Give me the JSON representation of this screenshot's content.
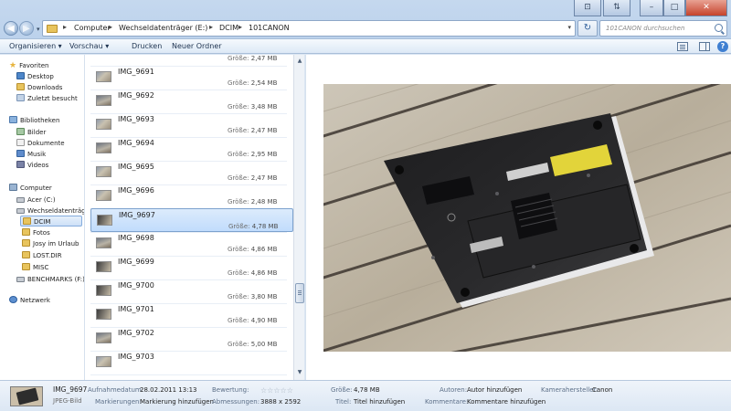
{
  "window": {
    "controls": {
      "minimize": "–",
      "maximize": "□",
      "close": "✕"
    }
  },
  "address": {
    "crumbs": [
      "Computer",
      "Wechseldatenträger (E:)",
      "DCIM",
      "101CANON"
    ]
  },
  "search": {
    "placeholder": "101CANON durchsuchen"
  },
  "toolbar": {
    "organize": "Organisieren ▾",
    "preview": "Vorschau ▾",
    "print": "Drucken",
    "new_folder": "Neuer Ordner"
  },
  "navpane": {
    "favorites": "Favoriten",
    "desktop": "Desktop",
    "downloads": "Downloads",
    "recent": "Zuletzt besucht",
    "libraries": "Bibliotheken",
    "pictures": "Bilder",
    "documents": "Dokumente",
    "music": "Musik",
    "videos": "Videos",
    "computer": "Computer",
    "drive_c": "Acer (C:)",
    "drive_e": "Wechseldatenträger",
    "dcim": "DCIM",
    "fotos": "Fotos",
    "urlaub": "Josy im Urlaub",
    "lostdir": "LOST.DIR",
    "misc": "MISC",
    "drive_f": "BENCHMARKS (F:)",
    "network": "Netzwerk"
  },
  "filelist": {
    "size_label": "Größe:",
    "partial_top_size": "2,47 MB",
    "files": [
      {
        "name": "IMG_9691",
        "size": "2,54 MB"
      },
      {
        "name": "IMG_9692",
        "size": "3,48 MB"
      },
      {
        "name": "IMG_9693",
        "size": "2,47 MB"
      },
      {
        "name": "IMG_9694",
        "size": "2,95 MB"
      },
      {
        "name": "IMG_9695",
        "size": "2,47 MB"
      },
      {
        "name": "IMG_9696",
        "size": "2,48 MB"
      },
      {
        "name": "IMG_9697",
        "size": "4,78 MB"
      },
      {
        "name": "IMG_9698",
        "size": "4,86 MB"
      },
      {
        "name": "IMG_9699",
        "size": "4,86 MB"
      },
      {
        "name": "IMG_9700",
        "size": "3,80 MB"
      },
      {
        "name": "IMG_9701",
        "size": "4,90 MB"
      },
      {
        "name": "IMG_9702",
        "size": "5,00 MB"
      },
      {
        "name": "IMG_9703",
        "size": ""
      }
    ],
    "selected": "IMG_9697"
  },
  "details": {
    "file_name": "IMG_9697",
    "file_type": "JPEG-Bild",
    "date_label": "Aufnahmedatum:",
    "date_value": "28.02.2011 13:13",
    "tags_label": "Markierungen:",
    "tags_value": "Markierung hinzufügen",
    "rating_label": "Bewertung:",
    "rating_value": 0,
    "dimensions_label": "Abmessungen:",
    "dimensions_value": "3888 x 2592",
    "size_label": "Größe:",
    "size_value": "4,78 MB",
    "title_label": "Titel:",
    "title_value": "Titel hinzufügen",
    "authors_label": "Autoren:",
    "authors_value": "Autor hinzufügen",
    "comments_label": "Kommentare:",
    "comments_value": "Kommentare hinzufügen",
    "camera_label": "Kamerahersteller:",
    "camera_value": "Canon"
  }
}
